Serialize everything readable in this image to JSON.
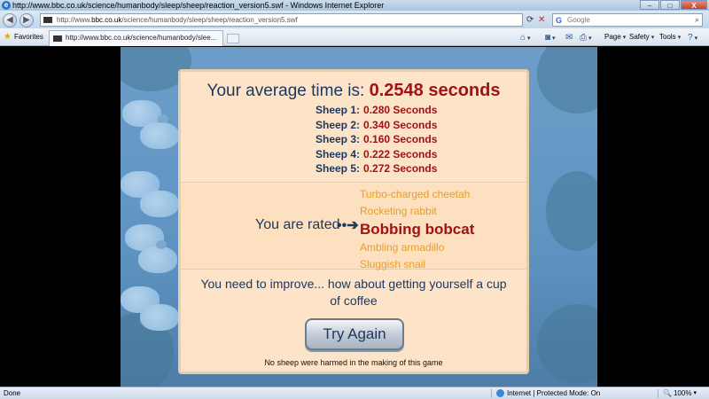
{
  "window": {
    "title": "http://www.bbc.co.uk/science/humanbody/sleep/sheep/reaction_version5.swf - Windows Internet Explorer",
    "buttons": {
      "minimize": "–",
      "maximize": "□",
      "close": "X"
    }
  },
  "address_bar": {
    "url_prefix": "http://www.",
    "url_domain": "bbc.co.uk",
    "url_path": "/science/humanbody/sleep/sheep/reaction_version5.swf",
    "search_placeholder": "Google",
    "search_logo": "G"
  },
  "command_bar": {
    "favorites": "Favorites",
    "tab_title": "http://www.bbc.co.uk/science/humanbody/slee...",
    "page": "Page",
    "safety": "Safety",
    "tools": "Tools",
    "help": "?"
  },
  "game": {
    "average_label": "Your average time is:",
    "average_value": "0.2548 seconds",
    "times": [
      {
        "label": "Sheep 1:",
        "value": "0.280 Seconds"
      },
      {
        "label": "Sheep 2:",
        "value": "0.340 Seconds"
      },
      {
        "label": "Sheep 3:",
        "value": "0.160 Seconds"
      },
      {
        "label": "Sheep 4:",
        "value": "0.222 Seconds"
      },
      {
        "label": "Sheep 5:",
        "value": "0.272 Seconds"
      }
    ],
    "rated_label": "You are rated",
    "ratings": [
      "Turbo-charged cheetah",
      "Rocketing rabbit",
      "Bobbing bobcat",
      "Ambling armadillo",
      "Sluggish snail"
    ],
    "active_rating": "Bobbing bobcat",
    "improve_text": "You need to improve... how about getting yourself a cup of coffee",
    "try_again": "Try Again",
    "footnote": "No sheep were harmed in the making of this game"
  },
  "status_bar": {
    "status": "Done",
    "zone": "Internet | Protected Mode: On",
    "zoom": "100%"
  },
  "colors": {
    "accent_red": "#a11214",
    "navy": "#1e3860",
    "orange": "#e59e2b",
    "panel_bg": "#fde4c8"
  }
}
